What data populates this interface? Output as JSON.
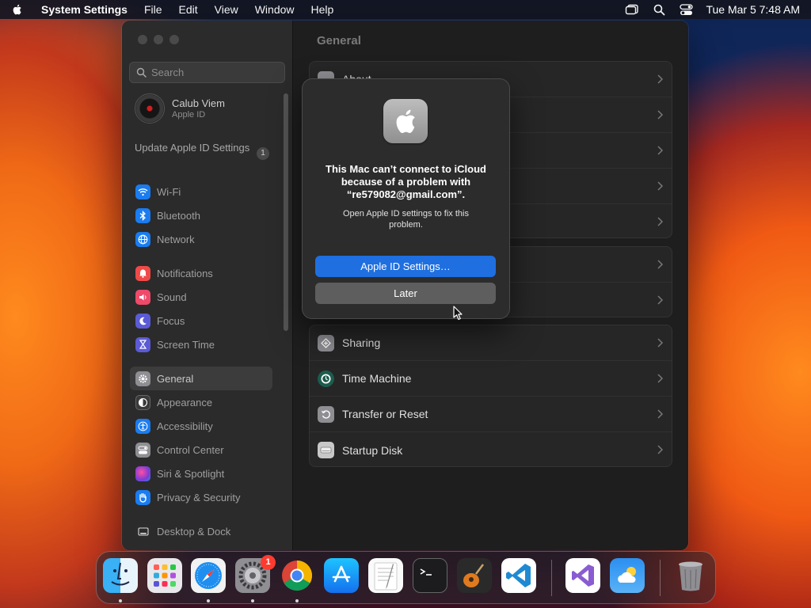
{
  "menubar": {
    "app_name": "System Settings",
    "items": [
      "File",
      "Edit",
      "View",
      "Window",
      "Help"
    ],
    "clock": "Tue Mar 5  7:48 AM"
  },
  "sidebar": {
    "search_placeholder": "Search",
    "account": {
      "name": "Calub Viem",
      "subtitle": "Apple ID"
    },
    "update": {
      "label": "Update Apple ID Settings",
      "badge": "1"
    },
    "groups": [
      [
        {
          "label": "Wi-Fi",
          "icon": "wifi-icon",
          "color": "#1a7cf0"
        },
        {
          "label": "Bluetooth",
          "icon": "bluetooth-icon",
          "color": "#1a7cf0"
        },
        {
          "label": "Network",
          "icon": "globe-icon",
          "color": "#1a7cf0"
        }
      ],
      [
        {
          "label": "Notifications",
          "icon": "bell-icon",
          "color": "#ef4a48"
        },
        {
          "label": "Sound",
          "icon": "speaker-icon",
          "color": "#ef4a6a"
        },
        {
          "label": "Focus",
          "icon": "moon-icon",
          "color": "#5b5bd6"
        },
        {
          "label": "Screen Time",
          "icon": "hourglass-icon",
          "color": "#5b5bd6"
        }
      ],
      [
        {
          "label": "General",
          "icon": "gear-icon",
          "color": "#8e8e93",
          "selected": true
        },
        {
          "label": "Appearance",
          "icon": "appearance-icon",
          "color": "#3a3a3a"
        },
        {
          "label": "Accessibility",
          "icon": "accessibility-icon",
          "color": "#1a7cf0"
        },
        {
          "label": "Control Center",
          "icon": "control-center-icon",
          "color": "#8e8e93"
        },
        {
          "label": "Siri & Spotlight",
          "icon": "siri-icon",
          "color": "#b04ad8"
        },
        {
          "label": "Privacy & Security",
          "icon": "hand-icon",
          "color": "#1a7cf0"
        }
      ],
      [
        {
          "label": "Desktop & Dock",
          "icon": "dock-icon",
          "color": "#2c2c2c"
        }
      ]
    ]
  },
  "content": {
    "title": "General",
    "group1_first": "About",
    "group3": [
      {
        "label": "Sharing",
        "icon": "sharing-icon"
      },
      {
        "label": "Time Machine",
        "icon": "time-machine-icon"
      },
      {
        "label": "Transfer or Reset",
        "icon": "reset-icon"
      },
      {
        "label": "Startup Disk",
        "icon": "disk-icon"
      }
    ]
  },
  "dialog": {
    "title": "This Mac can’t connect to iCloud because of a problem with “re579082@gmail.com”.",
    "body": "Open Apple ID settings to fix this problem.",
    "primary_button": "Apple ID Settings…",
    "secondary_button": "Later"
  },
  "dock": {
    "apps": [
      {
        "name": "Finder",
        "icon": "finder-icon"
      },
      {
        "name": "Launchpad",
        "icon": "launchpad-icon"
      },
      {
        "name": "Safari",
        "icon": "safari-icon"
      },
      {
        "name": "System Settings",
        "icon": "system-settings-icon",
        "badge": "1"
      },
      {
        "name": "Google Chrome",
        "icon": "chrome-icon"
      },
      {
        "name": "App Store",
        "icon": "app-store-icon"
      },
      {
        "name": "TextEdit",
        "icon": "textedit-icon"
      },
      {
        "name": "Terminal",
        "icon": "terminal-icon"
      },
      {
        "name": "GarageBand",
        "icon": "guitar-icon"
      },
      {
        "name": "Visual Studio Code",
        "icon": "vscode-icon"
      },
      {
        "name": "Visual Studio",
        "icon": "visual-studio-icon"
      },
      {
        "name": "Weather",
        "icon": "weather-icon"
      },
      {
        "name": "Trash",
        "icon": "trash-icon"
      }
    ]
  }
}
